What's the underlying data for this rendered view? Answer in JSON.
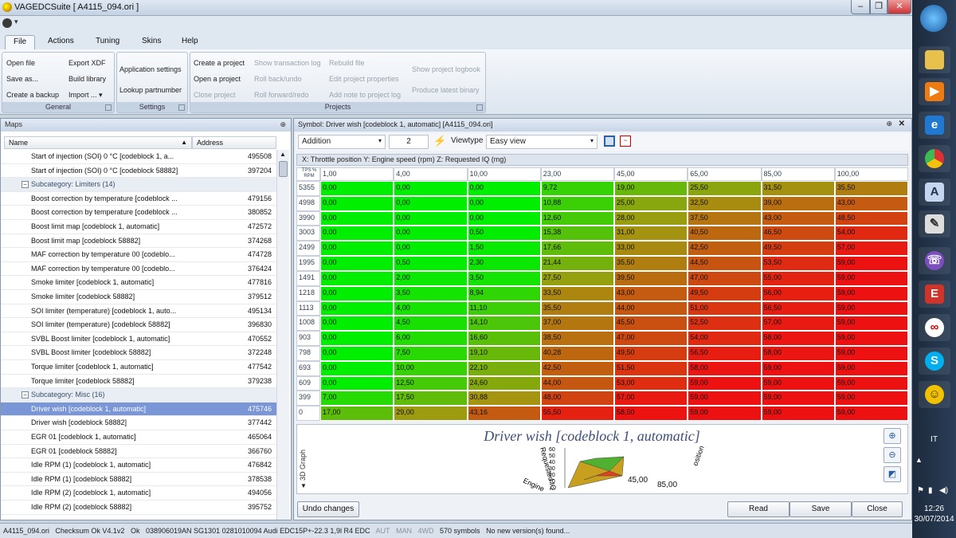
{
  "window": {
    "title": "VAGEDCSuite [ A4115_094.ori ]",
    "minimize": "‒",
    "restore": "❐",
    "close": "✕"
  },
  "ribbon": {
    "tabs": [
      {
        "label": "File"
      },
      {
        "label": "Actions"
      },
      {
        "label": "Tuning"
      },
      {
        "label": "Skins"
      },
      {
        "label": "Help"
      }
    ],
    "general": {
      "label": "General",
      "open_file": "Open file",
      "save_as": "Save as...",
      "create_backup": "Create a backup",
      "export_xdf": "Export XDF",
      "build_library": "Build library",
      "import": "Import ... ▾"
    },
    "settings": {
      "label": "Settings",
      "app_settings": "Application settings",
      "lookup": "Lookup partnumber"
    },
    "projects": {
      "label": "Projects",
      "create": "Create a project",
      "open": "Open a project",
      "close": "Close project",
      "show_log": "Show transaction log",
      "rollback": "Roll back/undo",
      "rollforward": "Roll forward/redo",
      "rebuild": "Rebuild file",
      "edit_props": "Edit project properties",
      "add_note": "Add note to project log",
      "show_logbook": "Show project logbook",
      "produce_binary": "Produce latest binary"
    }
  },
  "maps_panel": {
    "title": "Maps",
    "pin": "⊕",
    "col_name": "Name",
    "col_address": "Address",
    "rows": [
      {
        "type": "item",
        "name": "Start of injection (SOI) 0 °C [codeblock 1, a...",
        "address": "495508"
      },
      {
        "type": "item",
        "name": "Start of injection (SOI) 0 °C [codeblock 58882]",
        "address": "397204"
      },
      {
        "type": "sub",
        "name": "Subcategory: Limiters (14)",
        "address": ""
      },
      {
        "type": "item",
        "name": "Boost correction by temperature [codeblock ...",
        "address": "479156"
      },
      {
        "type": "item",
        "name": "Boost correction by temperature [codeblock ...",
        "address": "380852"
      },
      {
        "type": "item",
        "name": "Boost limit map [codeblock 1, automatic]",
        "address": "472572"
      },
      {
        "type": "item",
        "name": "Boost limit map [codeblock 58882]",
        "address": "374268"
      },
      {
        "type": "item",
        "name": "MAF correction by temperature 00 [codeblo...",
        "address": "474728"
      },
      {
        "type": "item",
        "name": "MAF correction by temperature 00 [codeblo...",
        "address": "376424"
      },
      {
        "type": "item",
        "name": "Smoke limiter [codeblock 1, automatic]",
        "address": "477816"
      },
      {
        "type": "item",
        "name": "Smoke limiter [codeblock 58882]",
        "address": "379512"
      },
      {
        "type": "item",
        "name": "SOI limiter (temperature) [codeblock 1, auto...",
        "address": "495134"
      },
      {
        "type": "item",
        "name": "SOI limiter (temperature) [codeblock 58882]",
        "address": "396830"
      },
      {
        "type": "item",
        "name": "SVBL Boost limiter [codeblock 1, automatic]",
        "address": "470552"
      },
      {
        "type": "item",
        "name": "SVBL Boost limiter [codeblock 58882]",
        "address": "372248"
      },
      {
        "type": "item",
        "name": "Torque limiter [codeblock 1, automatic]",
        "address": "477542"
      },
      {
        "type": "item",
        "name": "Torque limiter [codeblock 58882]",
        "address": "379238"
      },
      {
        "type": "sub",
        "name": "Subcategory: Misc (16)",
        "address": ""
      },
      {
        "type": "sel",
        "name": "Driver wish [codeblock 1, automatic]",
        "address": "475746"
      },
      {
        "type": "item",
        "name": "Driver wish [codeblock 58882]",
        "address": "377442"
      },
      {
        "type": "item",
        "name": "EGR 01 [codeblock 1, automatic]",
        "address": "465064"
      },
      {
        "type": "item",
        "name": "EGR 01 [codeblock 58882]",
        "address": "366760"
      },
      {
        "type": "item",
        "name": "Idle RPM (1) [codeblock 1, automatic]",
        "address": "476842"
      },
      {
        "type": "item",
        "name": "Idle RPM (1) [codeblock 58882]",
        "address": "378538"
      },
      {
        "type": "item",
        "name": "Idle RPM (2) [codeblock 1, automatic]",
        "address": "494056"
      },
      {
        "type": "item",
        "name": "Idle RPM (2) [codeblock 58882]",
        "address": "395752"
      }
    ]
  },
  "symbol_panel": {
    "title": "Symbol: Driver wish [codeblock 1, automatic] [A4115_094.ori]",
    "mode": "Addition",
    "amount": "2",
    "viewtype_label": "Viewtype",
    "viewtype": "Easy view",
    "axes": "X: Throttle  position Y: Engine speed (rpm) Z: Requested IQ (mg)",
    "corner": "TPS % RPM",
    "x_axis": [
      "1,00",
      "4,00",
      "10,00",
      "23,00",
      "45,00",
      "65,00",
      "85,00",
      "100,00"
    ],
    "y_axis": [
      "5355",
      "4998",
      "3990",
      "3003",
      "2499",
      "1995",
      "1491",
      "1218",
      "1113",
      "1008",
      "903",
      "798",
      "693",
      "609",
      "399",
      "0"
    ],
    "values": [
      [
        "0,00",
        "0,00",
        "0,00",
        "9,72",
        "19,00",
        "25,50",
        "31,50",
        "35,50"
      ],
      [
        "0,00",
        "0,00",
        "0,00",
        "10,88",
        "25,00",
        "32,50",
        "39,00",
        "43,00"
      ],
      [
        "0,00",
        "0,00",
        "0,00",
        "12,60",
        "28,00",
        "37,50",
        "43,00",
        "48,50"
      ],
      [
        "0,00",
        "0,00",
        "0,50",
        "15,38",
        "31,00",
        "40,50",
        "46,50",
        "54,00"
      ],
      [
        "0,00",
        "0,00",
        "1,50",
        "17,66",
        "33,00",
        "42,50",
        "49,50",
        "57,00"
      ],
      [
        "0,00",
        "0,50",
        "2,30",
        "21,44",
        "35,50",
        "44,50",
        "53,50",
        "59,00"
      ],
      [
        "0,00",
        "2,00",
        "3,50",
        "27,50",
        "39,50",
        "47,00",
        "55,00",
        "59,00"
      ],
      [
        "0,00",
        "3,50",
        "8,94",
        "33,50",
        "43,00",
        "49,50",
        "56,00",
        "59,00"
      ],
      [
        "0,00",
        "4,00",
        "11,10",
        "35,50",
        "44,00",
        "51,00",
        "56,50",
        "59,00"
      ],
      [
        "0,00",
        "4,50",
        "14,10",
        "37,00",
        "45,50",
        "52,50",
        "57,00",
        "59,00"
      ],
      [
        "0,00",
        "6,00",
        "16,60",
        "38,50",
        "47,00",
        "54,00",
        "58,00",
        "59,00"
      ],
      [
        "0,00",
        "7,50",
        "19,10",
        "40,28",
        "49,50",
        "56,50",
        "58,00",
        "59,00"
      ],
      [
        "0,00",
        "10,00",
        "22,10",
        "42,50",
        "51,50",
        "58,00",
        "59,00",
        "59,00"
      ],
      [
        "0,00",
        "12,50",
        "24,60",
        "44,00",
        "53,00",
        "59,00",
        "59,00",
        "59,00"
      ],
      [
        "7,00",
        "17,50",
        "30,88",
        "48,00",
        "57,00",
        "59,00",
        "59,00",
        "59,00"
      ],
      [
        "17,00",
        "29,00",
        "43,16",
        "55,50",
        "58,50",
        "59,00",
        "59,00",
        "59,00"
      ]
    ],
    "graph_tab": "3D Graph",
    "graph_title": "Driver wish [codeblock 1, automatic]",
    "graph_labels": {
      "z_ticks": [
        "60",
        "50",
        "40",
        "30",
        "20",
        "10",
        "0"
      ],
      "x_a": "45,00",
      "x_b": "85,00",
      "axis1": "Requested IQ",
      "axis2": "Engine",
      "axis3": "osition"
    },
    "undo": "Undo changes",
    "read": "Read",
    "save": "Save",
    "close": "Close"
  },
  "status": {
    "file": "A4115_094.ori",
    "checksum": "Checksum Ok V4.1v2",
    "ok": "Ok",
    "info": "038906019AN SG1301   0281010094 Audi EDC15P+-22.3 1,9l R4 EDC",
    "aut": "AUT",
    "man": "MAN",
    "wd": "4WD",
    "symbols": "570 symbols",
    "version": "No new version(s) found..."
  },
  "taskbar": {
    "lang": "IT",
    "time": "12:26",
    "date": "30/07/2014"
  },
  "colors": {
    "cold": "#00ee00",
    "warm": "#a09a10",
    "hot": "#ee1111",
    "selection": "#7a96d6"
  }
}
